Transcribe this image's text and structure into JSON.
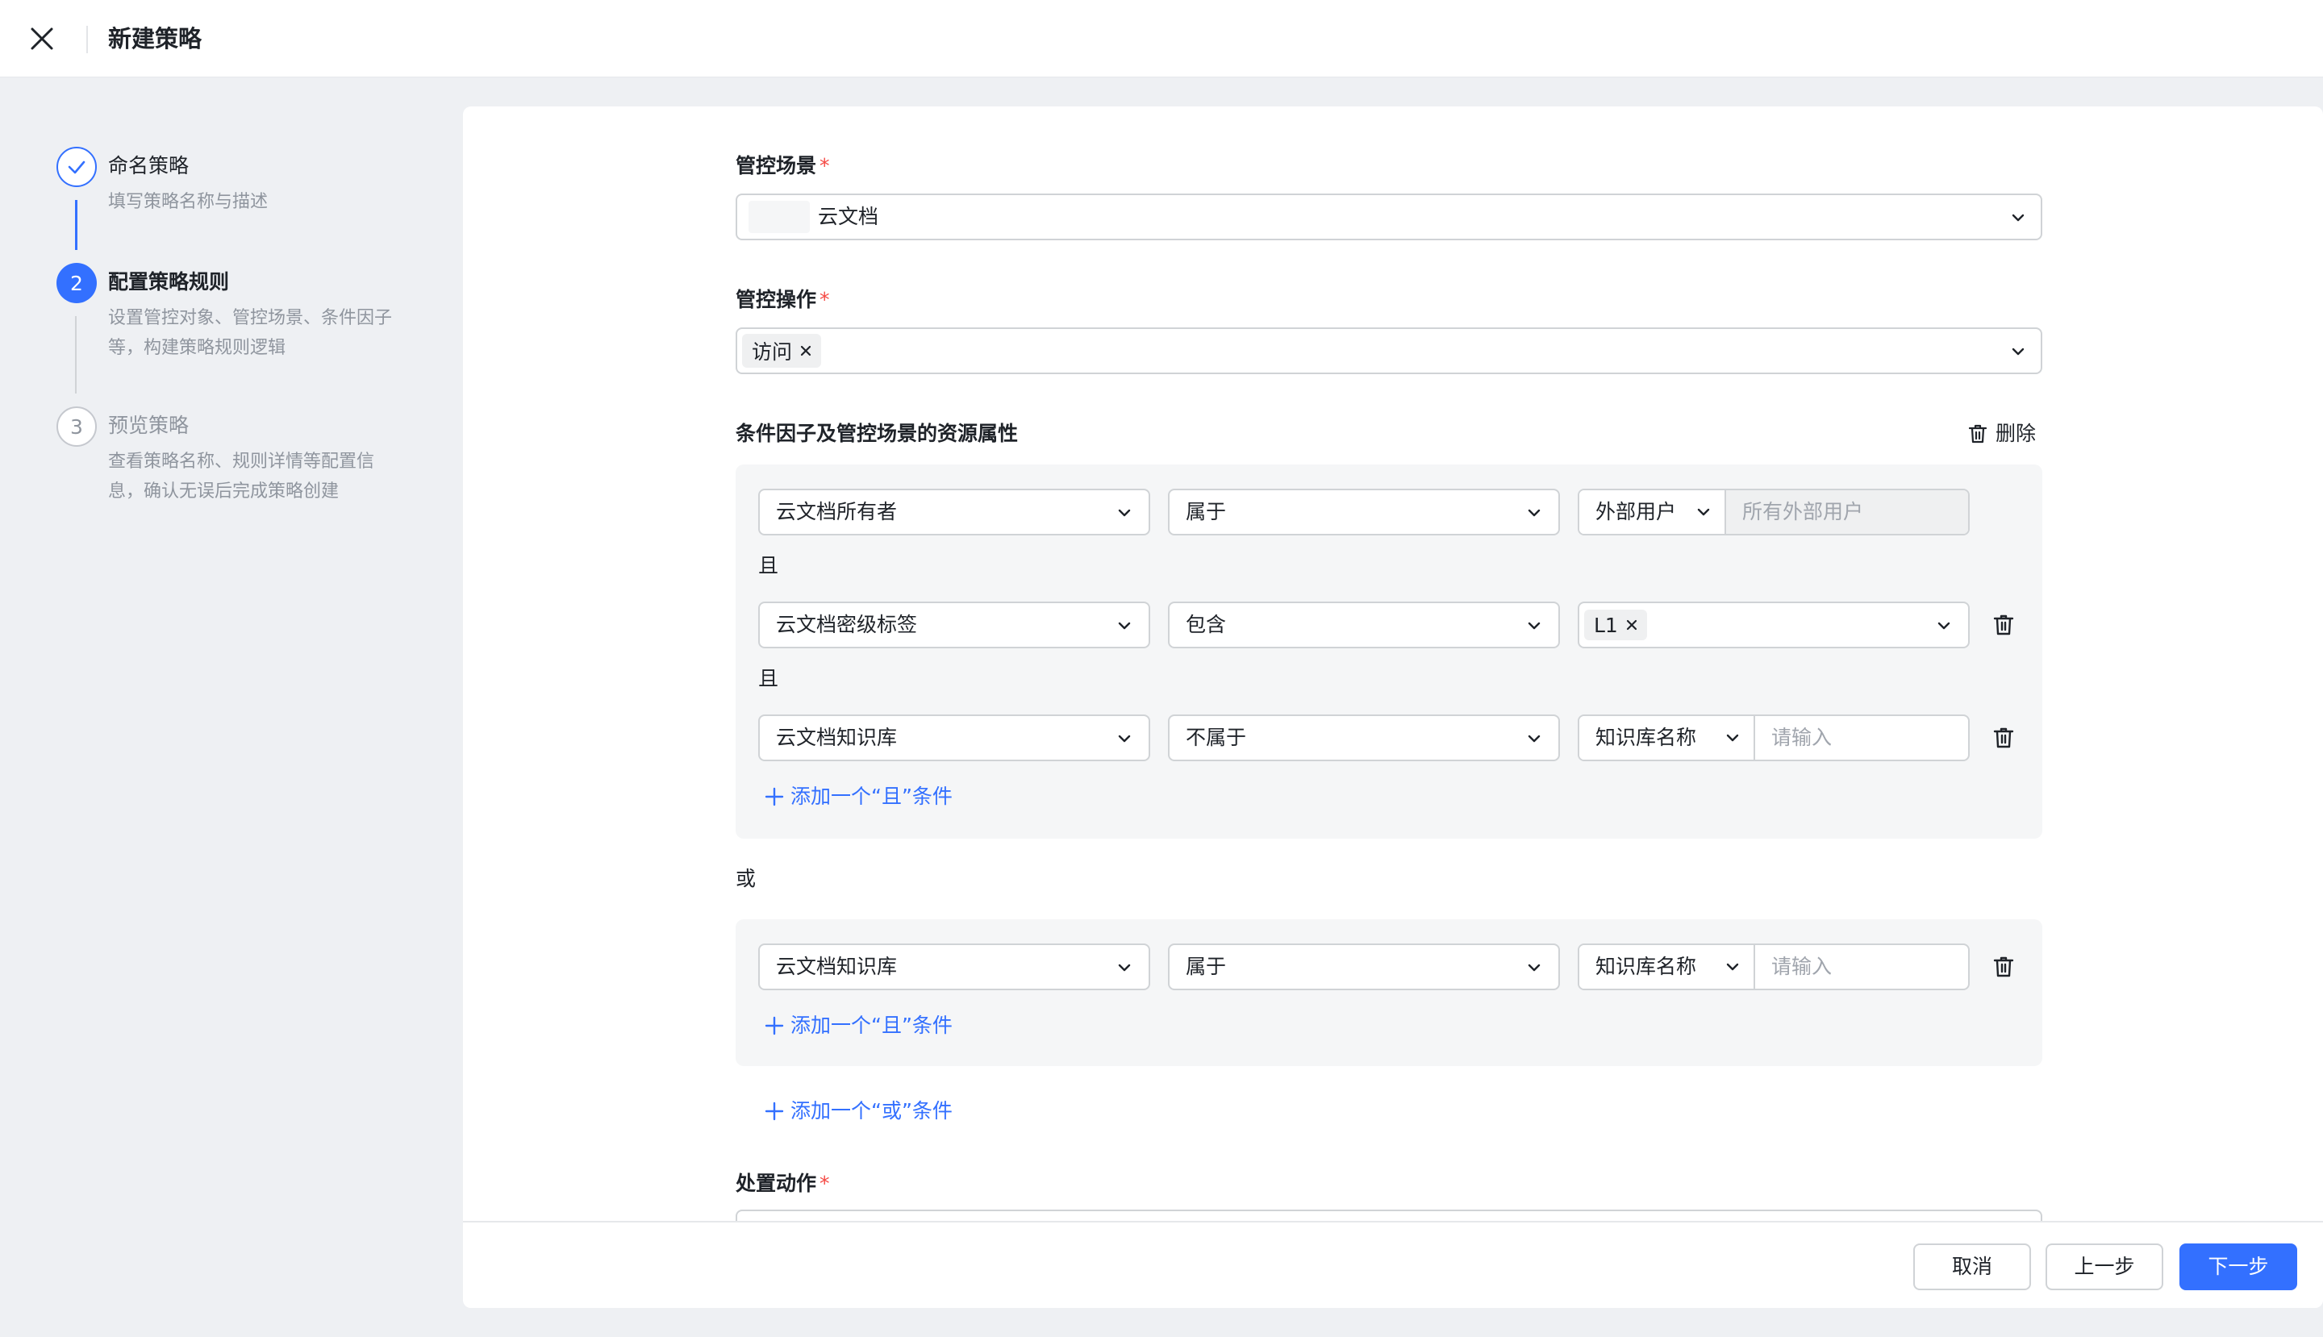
{
  "header": {
    "title": "新建策略"
  },
  "steps": [
    {
      "index": "1",
      "title": "命名策略",
      "desc": "填写策略名称与描述",
      "state": "done"
    },
    {
      "index": "2",
      "title": "配置策略规则",
      "desc": "设置管控对象、管控场景、条件因子等，构建策略规则逻辑",
      "state": "active"
    },
    {
      "index": "3",
      "title": "预览策略",
      "desc": "查看策略名称、规则详情等配置信息，确认无误后完成策略创建",
      "state": "todo"
    }
  ],
  "form": {
    "scene": {
      "label": "管控场景",
      "required_mark": "*",
      "value": "云文档"
    },
    "operation": {
      "label": "管控操作",
      "required_mark": "*",
      "tags": [
        "访问"
      ]
    },
    "conditions": {
      "label": "条件因子及管控场景的资源属性",
      "delete_label": "删除",
      "and_label": "且",
      "or_label": "或",
      "group1": {
        "rows": [
          {
            "attr": "云文档所有者",
            "op": "属于",
            "combo_type": "外部用户",
            "combo_placeholder": "所有外部用户"
          },
          {
            "attr": "云文档密级标签",
            "op": "包含",
            "tags": [
              "L1"
            ]
          },
          {
            "attr": "云文档知识库",
            "op": "不属于",
            "combo_type": "知识库名称",
            "combo_placeholder": "请输入"
          }
        ],
        "add_and": "添加一个“且”条件"
      },
      "group2": {
        "rows": [
          {
            "attr": "云文档知识库",
            "op": "属于",
            "combo_type": "知识库名称",
            "combo_placeholder": "请输入"
          }
        ],
        "add_and": "添加一个“且”条件"
      },
      "add_or": "添加一个“或”条件"
    },
    "action": {
      "label": "处置动作",
      "required_mark": "*"
    }
  },
  "footer": {
    "cancel": "取消",
    "prev": "上一步",
    "next": "下一步"
  },
  "colors": {
    "primary": "#3370ff",
    "required": "#f54a45",
    "border": "#d0d3d6",
    "section_bg": "#f5f6f7"
  }
}
